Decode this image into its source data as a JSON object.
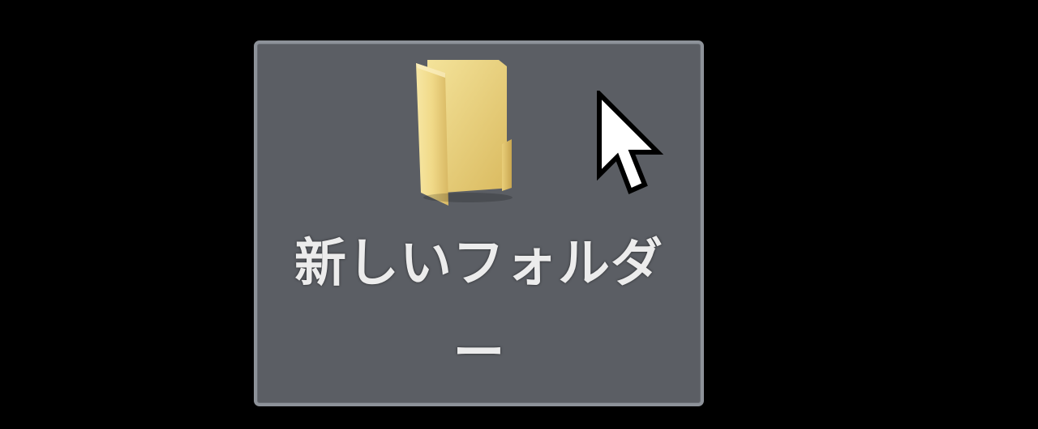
{
  "desktop": {
    "icon": {
      "label_line1": "新しいフォルダ",
      "label_line2": "ー",
      "icon_name": "folder-icon",
      "selected": true,
      "colors": {
        "selection_bg": "#5b5e64",
        "selection_border": "#8d9299",
        "folder_yellow": "#f2dc8a",
        "label_text": "#ececec"
      }
    },
    "cursor": {
      "icon_name": "mouse-pointer-icon"
    },
    "background": "#000000"
  }
}
